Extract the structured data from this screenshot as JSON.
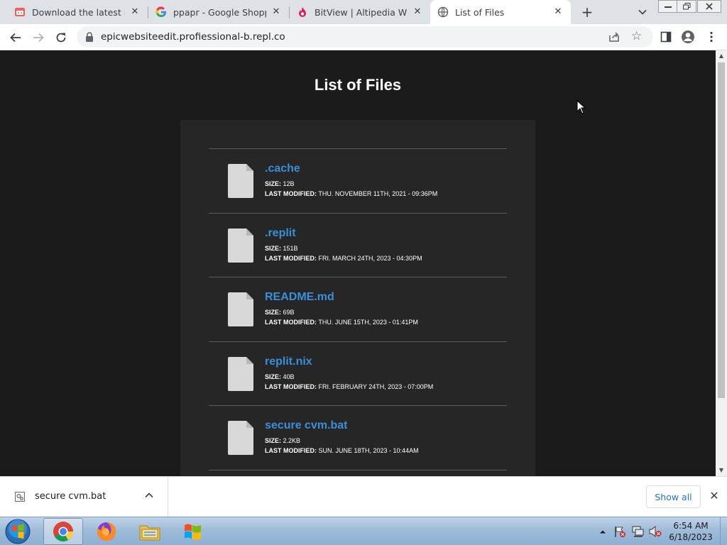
{
  "browser": {
    "tabs": [
      {
        "title": "Download the latest indie",
        "favicon": "itch-icon"
      },
      {
        "title": "ppapr - Google Shopping",
        "favicon": "google-icon"
      },
      {
        "title": "BitView | Altipedia Wiki | F",
        "favicon": "fandom-icon"
      },
      {
        "title": "List of Files",
        "favicon": "globe-icon"
      }
    ],
    "url": "epicwebsiteedit.profiessional-b.repl.co"
  },
  "page": {
    "title": "List of Files",
    "size_label": "Size:",
    "modified_label": "Last Modified:",
    "files": [
      {
        "name": ".cache",
        "size": "12b",
        "modified": "Thu. November 11th, 2021 - 09:36pm"
      },
      {
        "name": ".replit",
        "size": "151b",
        "modified": "Fri. March 24th, 2023 - 04:30pm"
      },
      {
        "name": "README.md",
        "size": "69b",
        "modified": "Thu. June 15th, 2023 - 01:41pm"
      },
      {
        "name": "replit.nix",
        "size": "40b",
        "modified": "Fri. February 24th, 2023 - 07:00pm"
      },
      {
        "name": "secure cvm.bat",
        "size": "2.2kb",
        "modified": "Sun. June 18th, 2023 - 10:44am"
      }
    ]
  },
  "downloads": {
    "item": "secure cvm.bat",
    "show_all": "Show all"
  },
  "taskbar": {
    "time": "6:54 AM",
    "date": "6/18/2023"
  },
  "colors": {
    "link": "#3a8fd9",
    "page_bg": "#1b1b1b",
    "panel_bg": "#262626"
  }
}
